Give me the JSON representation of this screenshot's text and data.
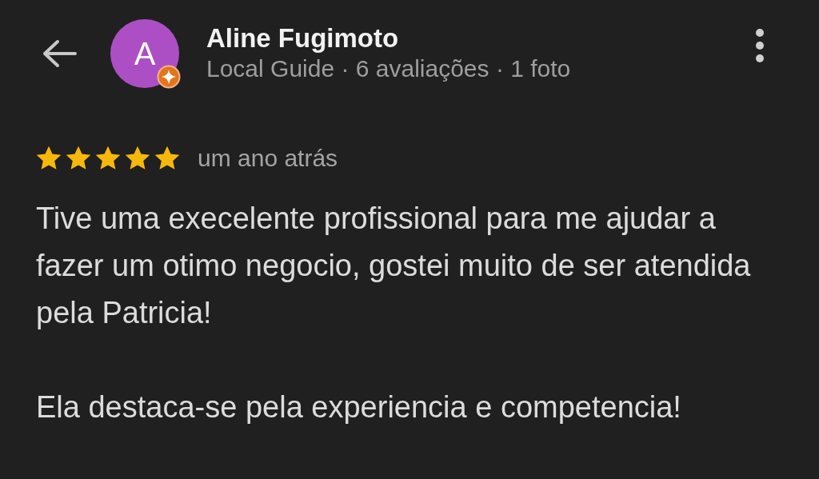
{
  "reviewer": {
    "avatar_letter": "A",
    "local_guide_badge": true,
    "name": "Aline Fugimoto",
    "subtitle": "Local Guide · 6 avaliações · 1 foto"
  },
  "review": {
    "stars": 5,
    "time": "um ano atrás",
    "paragraphs": [
      "Tive uma execelente profissional para me ajudar a fazer um otimo negocio, gostei muito de ser atendida pela Patricia!",
      "Ela destaca-se pela experiencia e competencia!"
    ]
  }
}
